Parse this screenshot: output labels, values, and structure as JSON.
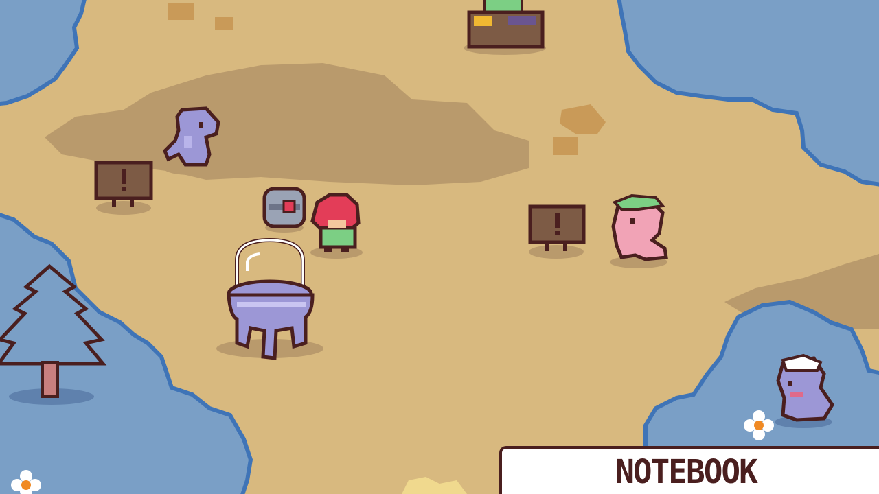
{
  "game": {
    "notebook_label": "NOTEBOOK"
  },
  "palette": {
    "sand": "#d8b97f",
    "sand_shadow": "#b99a6c",
    "water": "#7a9fc6",
    "water_edge": "#3f74b7",
    "outline": "#4a1f1f",
    "wood": "#7d5b45",
    "dino_purple": "#9c97d6",
    "dino_pink": "#f1a3b6",
    "helmet_red": "#e33d58",
    "shirt_green": "#7ccf84"
  },
  "icons": [
    "exclamation-sign-icon",
    "capsule-icon",
    "glass-dome-incubator-icon",
    "pine-tree-icon",
    "daisy-flower-icon"
  ]
}
